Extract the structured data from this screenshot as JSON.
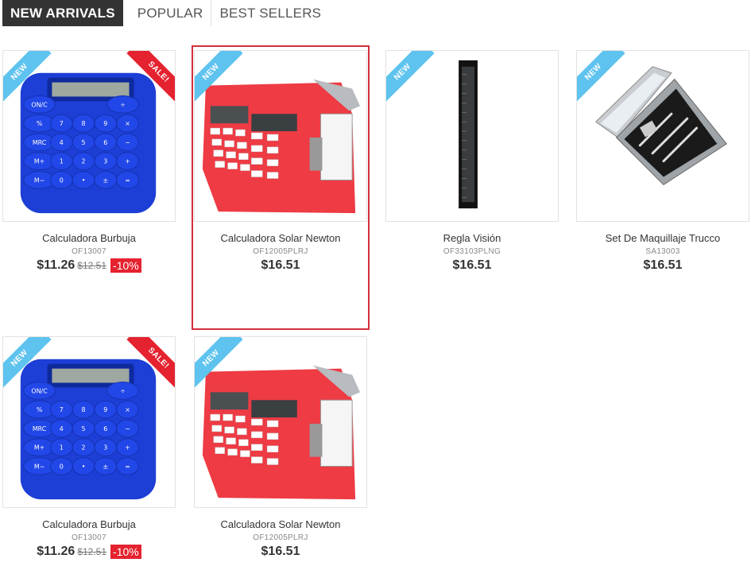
{
  "tabs": [
    {
      "label": "NEW ARRIVALS",
      "active": true
    },
    {
      "label": "POPULAR",
      "active": false
    },
    {
      "label": "BEST SELLERS",
      "active": false
    }
  ],
  "ribbons": {
    "new": "NEW",
    "sale": "SALE!"
  },
  "products": [
    {
      "name": "Calculadora Burbuja",
      "sku": "OF13007",
      "price": "$11.26",
      "old_price": "$12.51",
      "discount": "-10%",
      "image": "blue-bubble-calculator",
      "badges": [
        "NEW",
        "SALE!"
      ]
    },
    {
      "name": "Calculadora Solar Newton",
      "sku": "OF12005PLRJ",
      "price": "$16.51",
      "image": "red-solar-calculator",
      "badges": [
        "NEW"
      ]
    },
    {
      "name": "Regla Visión",
      "sku": "OF33103PLNG",
      "price": "$16.51",
      "image": "black-ruler",
      "badges": [
        "NEW"
      ]
    },
    {
      "name": "Set De Maquillaje Trucco",
      "sku": "SA13003",
      "price": "$16.51",
      "image": "makeup-case",
      "badges": [
        "NEW"
      ]
    },
    {
      "name": "Calculadora Burbuja",
      "sku": "OF13007",
      "price": "$11.26",
      "old_price": "$12.51",
      "discount": "-10%",
      "image": "blue-bubble-calculator",
      "badges": [
        "NEW",
        "SALE!"
      ]
    },
    {
      "name": "Calculadora Solar Newton",
      "sku": "OF12005PLRJ",
      "price": "$16.51",
      "image": "red-solar-calculator",
      "badges": [
        "NEW"
      ]
    }
  ],
  "colors": {
    "accent": "#e5222f",
    "new_ribbon": "#5ec3ee",
    "tab_active_bg": "#333333",
    "highlight_border": "#d32f3b"
  }
}
